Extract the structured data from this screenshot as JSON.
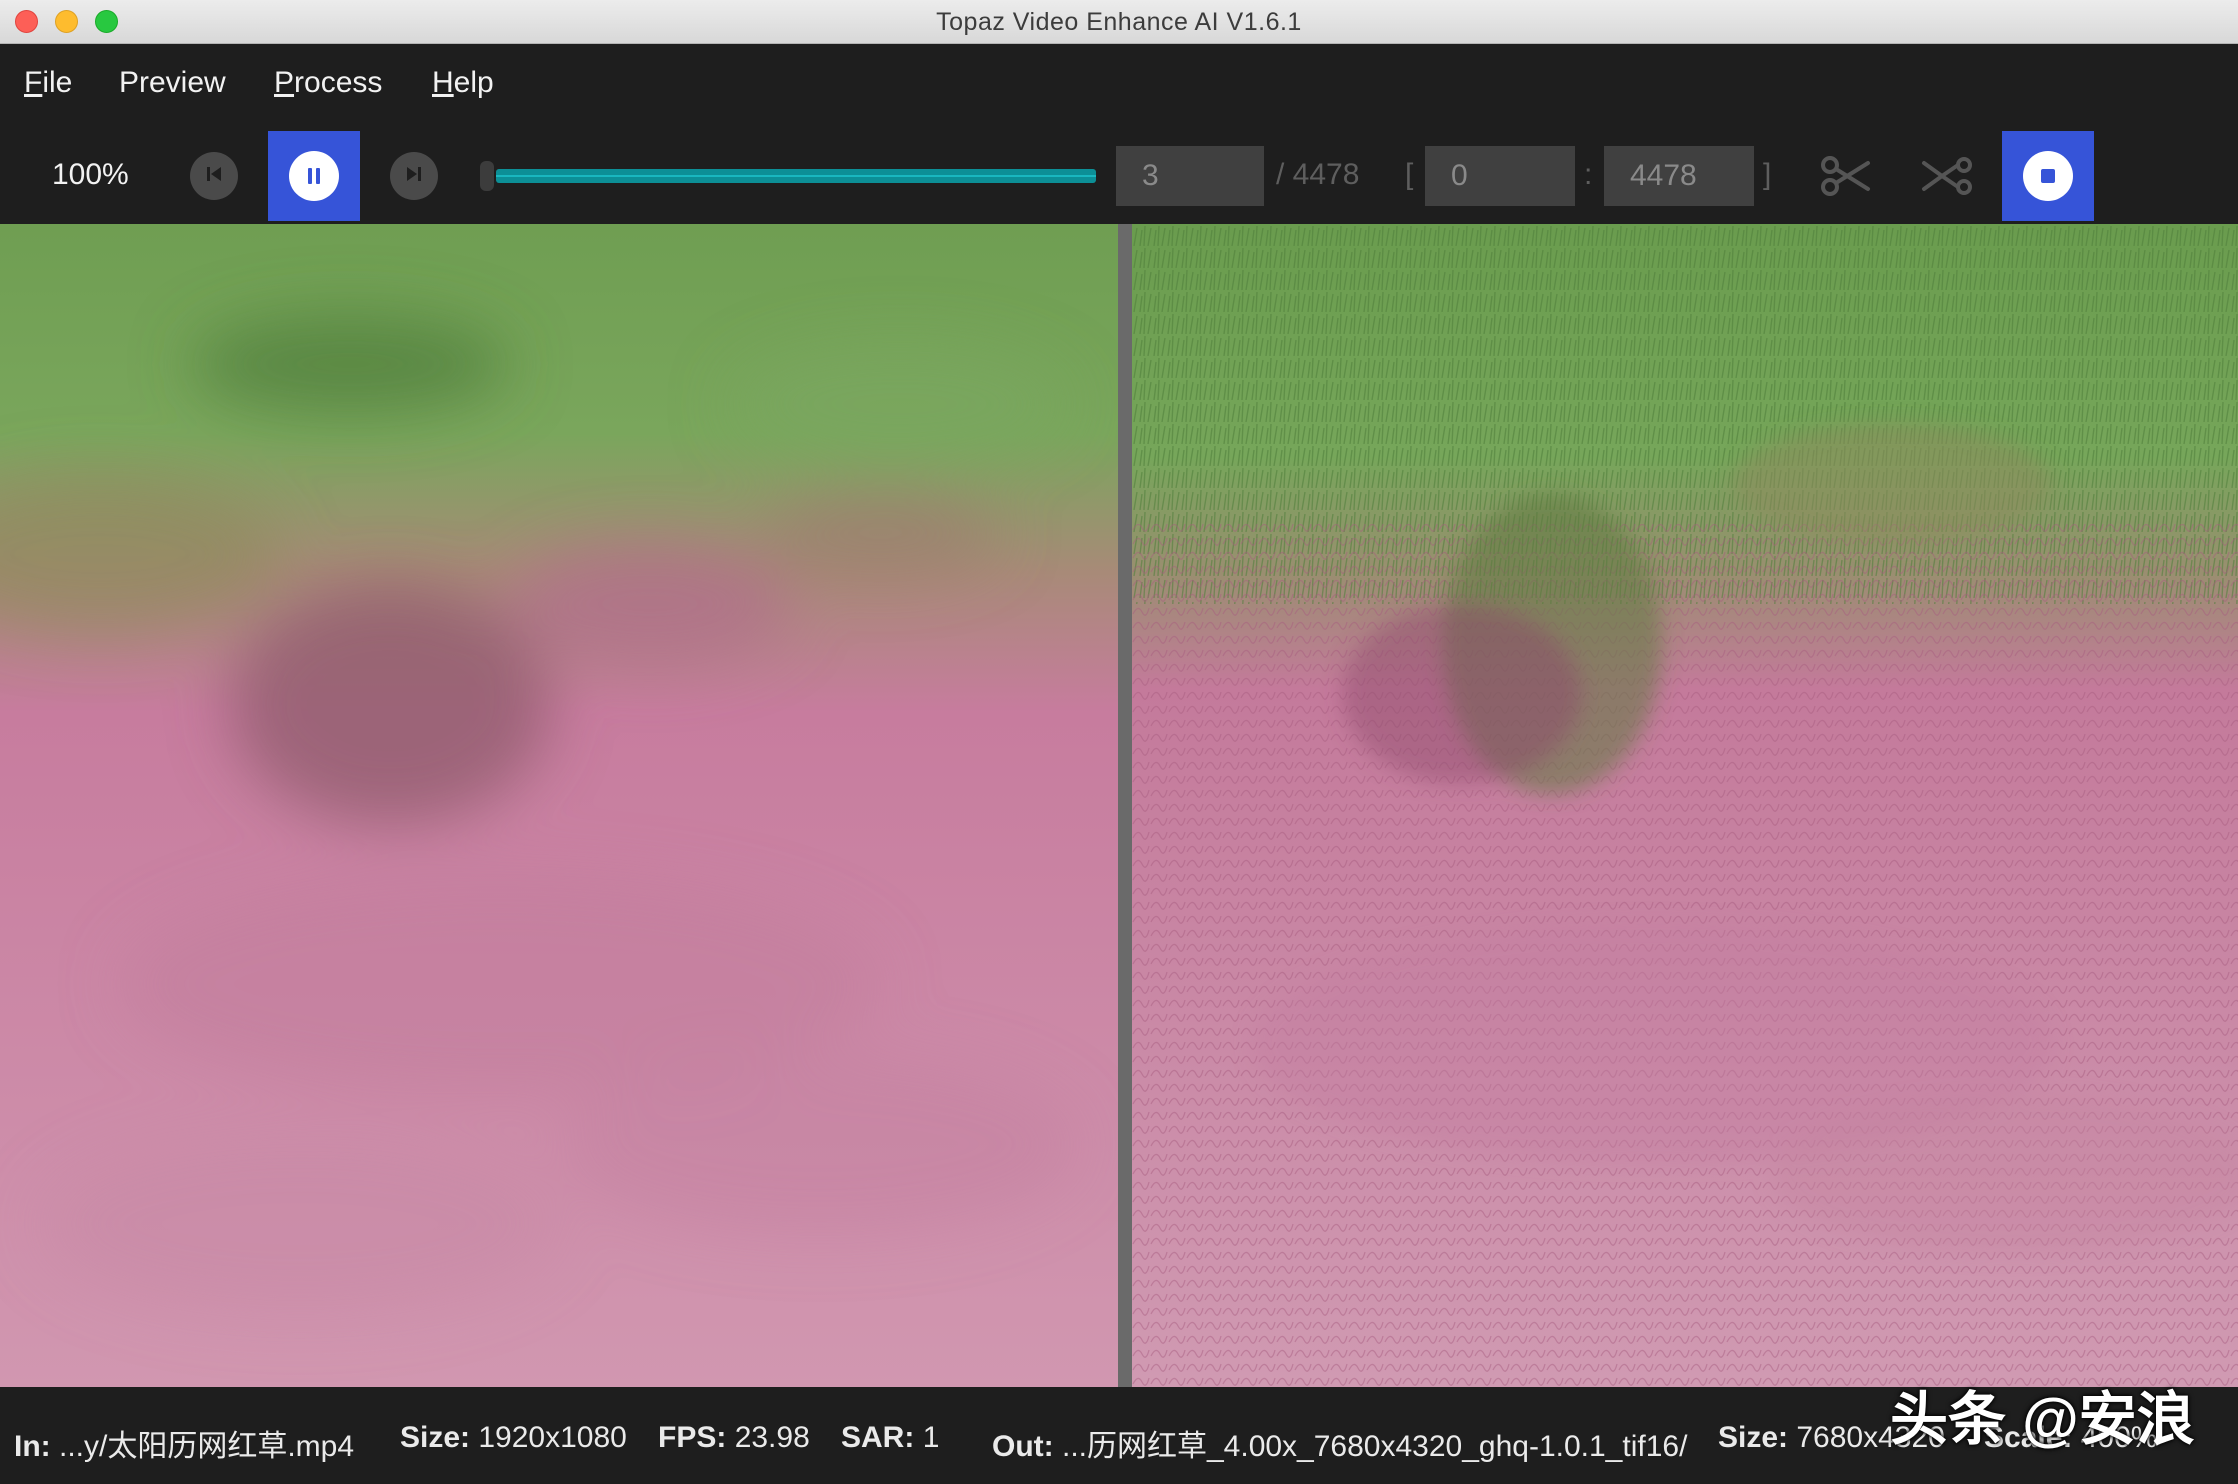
{
  "window": {
    "title": "Topaz Video Enhance AI V1.6.1"
  },
  "menu": {
    "items": [
      {
        "first": "F",
        "rest": "ile"
      },
      {
        "first": "Preview",
        "rest": ""
      },
      {
        "first": "P",
        "rest": "rocess"
      },
      {
        "first": "H",
        "rest": "elp"
      }
    ]
  },
  "toolbar": {
    "zoom": "100%",
    "progress_fraction": 1.0,
    "current_frame": "3",
    "total_frames": "/ 4478",
    "range_open": "[",
    "range_start": "0",
    "range_sep": ":",
    "range_end": "4478",
    "range_close": "]",
    "accent_color": "#3654d8",
    "progress_color": "#0c8f96"
  },
  "icons": {
    "prev": "skip-back-icon",
    "play_pause": "pause-icon",
    "next": "skip-forward-icon",
    "cut": "scissors-icon",
    "cut_range": "cut-range-icon",
    "stop": "stop-icon"
  },
  "status": {
    "in_label": "In:",
    "in_value": "...y/太阳历网红草.mp4",
    "in_size_label": "Size:",
    "in_size_value": "1920x1080",
    "fps_label": "FPS:",
    "fps_value": "23.98",
    "sar_label": "SAR:",
    "sar_value": "1",
    "out_label": "Out:",
    "out_value": "...历网红草_4.00x_7680x4320_ghq-1.0.1_tif16/",
    "out_size_label": "Size:",
    "out_size_value": "7680x4320",
    "scale_label": "Scale:",
    "scale_value": "400%"
  },
  "watermark": "头条 @安浪"
}
